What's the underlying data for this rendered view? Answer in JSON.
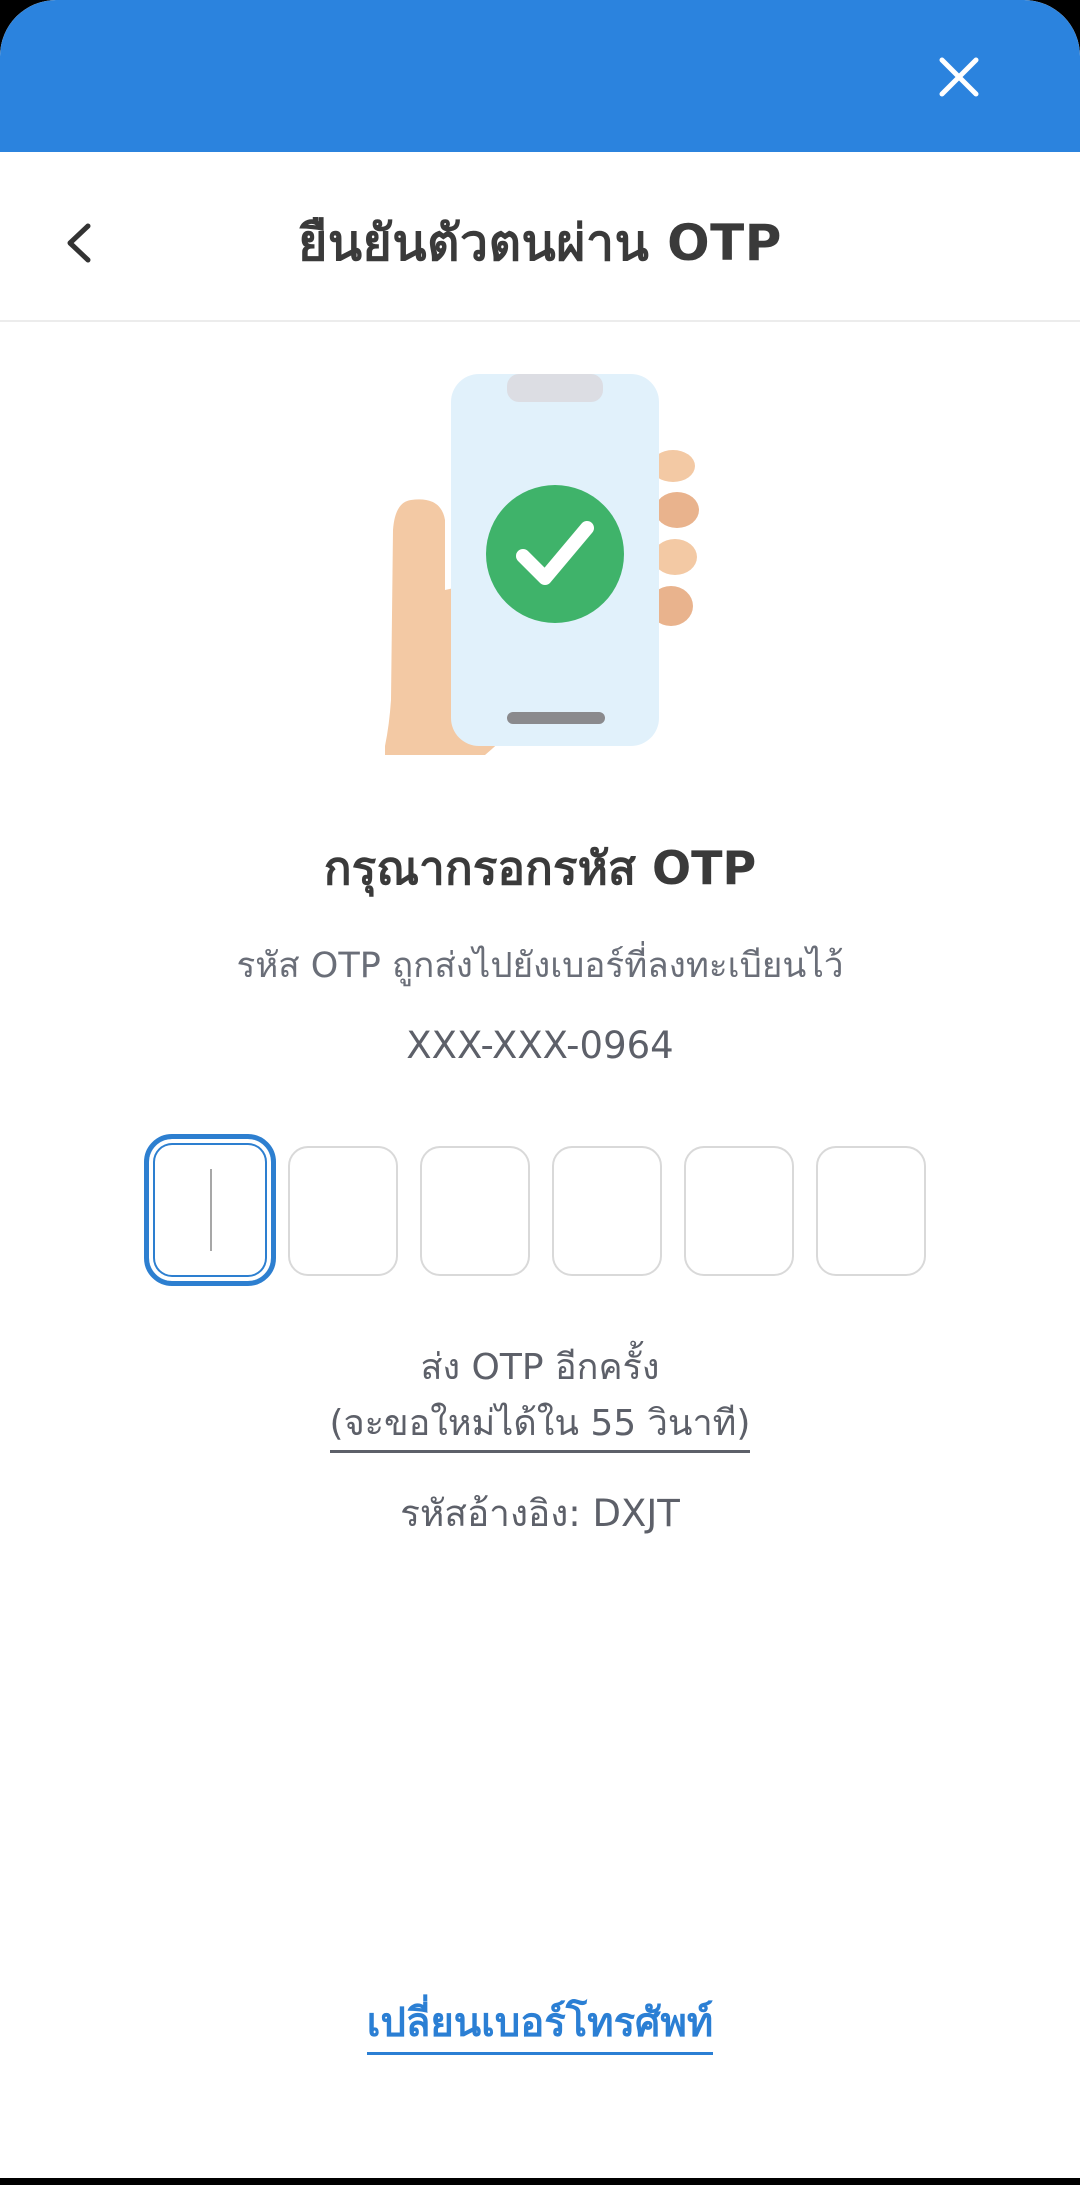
{
  "header": {
    "title": "ยืนยันตัวตนผ่าน OTP"
  },
  "main": {
    "heading": "กรุณากรอกรหัส OTP",
    "subtext": "รหัส OTP ถูกส่งไปยังเบอร์ที่ลงทะเบียนไว้",
    "phone_masked": "XXX-XXX-0964",
    "otp_digits": [
      "",
      "",
      "",
      "",
      "",
      ""
    ],
    "resend_label": "ส่ง OTP อีกครั้ง",
    "resend_countdown": "(จะขอใหม่ได้ใน 55 วินาที)",
    "reference": "รหัสอ้างอิง: DXJT",
    "change_phone_label": "เปลี่ยนเบอร์โทรศัพท์"
  },
  "icons": {
    "close": "close-icon",
    "back": "chevron-left-icon",
    "illustration": "phone-check-illustration"
  },
  "colors": {
    "accent": "#2b83de",
    "link": "#2b7fd4",
    "success": "#3fb36a",
    "text_primary": "#3a3a3a",
    "text_secondary": "#5d6069"
  }
}
